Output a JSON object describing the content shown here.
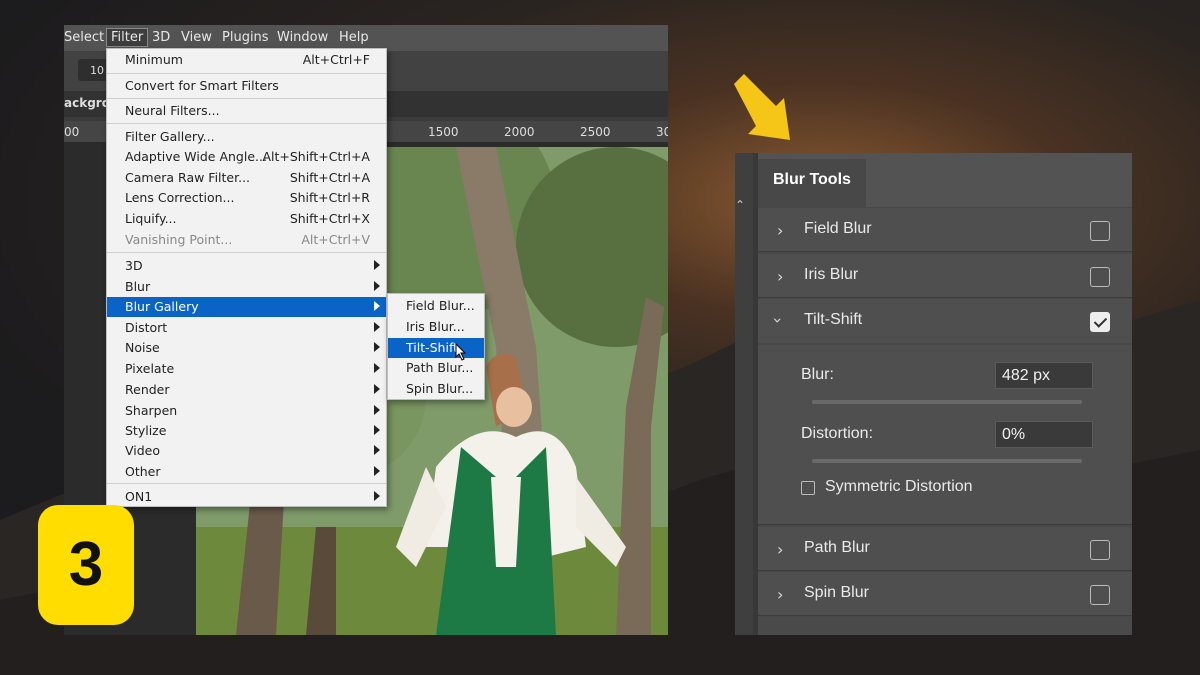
{
  "menubar": {
    "items": [
      "Select",
      "Filter",
      "3D",
      "View",
      "Plugins",
      "Window",
      "Help"
    ]
  },
  "options": {
    "field_value": "10"
  },
  "document_tab": {
    "label": "ackgro"
  },
  "ruler": {
    "ticks": [
      "00",
      "1500",
      "2000",
      "2500",
      "30"
    ]
  },
  "filter_menu": {
    "items": [
      {
        "label": "Minimum",
        "shortcut": "Alt+Ctrl+F"
      },
      {
        "label": "Convert for Smart Filters",
        "shortcut": ""
      },
      {
        "label": "Neural Filters...",
        "shortcut": ""
      },
      {
        "label": "Filter Gallery...",
        "shortcut": ""
      },
      {
        "label": "Adaptive Wide Angle...",
        "shortcut": "Alt+Shift+Ctrl+A"
      },
      {
        "label": "Camera Raw Filter...",
        "shortcut": "Shift+Ctrl+A"
      },
      {
        "label": "Lens Correction...",
        "shortcut": "Shift+Ctrl+R"
      },
      {
        "label": "Liquify...",
        "shortcut": "Shift+Ctrl+X"
      },
      {
        "label": "Vanishing Point...",
        "shortcut": "Alt+Ctrl+V"
      },
      {
        "label": "3D"
      },
      {
        "label": "Blur"
      },
      {
        "label": "Blur Gallery"
      },
      {
        "label": "Distort"
      },
      {
        "label": "Noise"
      },
      {
        "label": "Pixelate"
      },
      {
        "label": "Render"
      },
      {
        "label": "Sharpen"
      },
      {
        "label": "Stylize"
      },
      {
        "label": "Video"
      },
      {
        "label": "Other"
      },
      {
        "label": "ON1"
      }
    ]
  },
  "blur_gallery_submenu": {
    "items": [
      "Field Blur...",
      "Iris Blur...",
      "Tilt-Shift",
      "Path Blur...",
      "Spin Blur..."
    ]
  },
  "step_badge": {
    "number": "3"
  },
  "blur_tools_panel": {
    "title": "Blur Tools",
    "rows": [
      {
        "name": "Field Blur",
        "checked": false
      },
      {
        "name": "Iris Blur",
        "checked": false
      },
      {
        "name": "Tilt-Shift",
        "checked": true
      },
      {
        "name": "Path Blur",
        "checked": false
      },
      {
        "name": "Spin Blur",
        "checked": false
      }
    ],
    "tilt_shift": {
      "blur_label": "Blur:",
      "blur_value": "482 px",
      "blur_slider_fraction": 0.98,
      "distortion_label": "Distortion:",
      "distortion_value": "0%",
      "distortion_slider_fraction": 0.5,
      "symmetric_label": "Symmetric Distortion",
      "symmetric_checked": false
    }
  },
  "colors": {
    "accent_arrow": "#f5c518",
    "menu_highlight": "#0a64c8",
    "badge": "#ffdd00"
  }
}
